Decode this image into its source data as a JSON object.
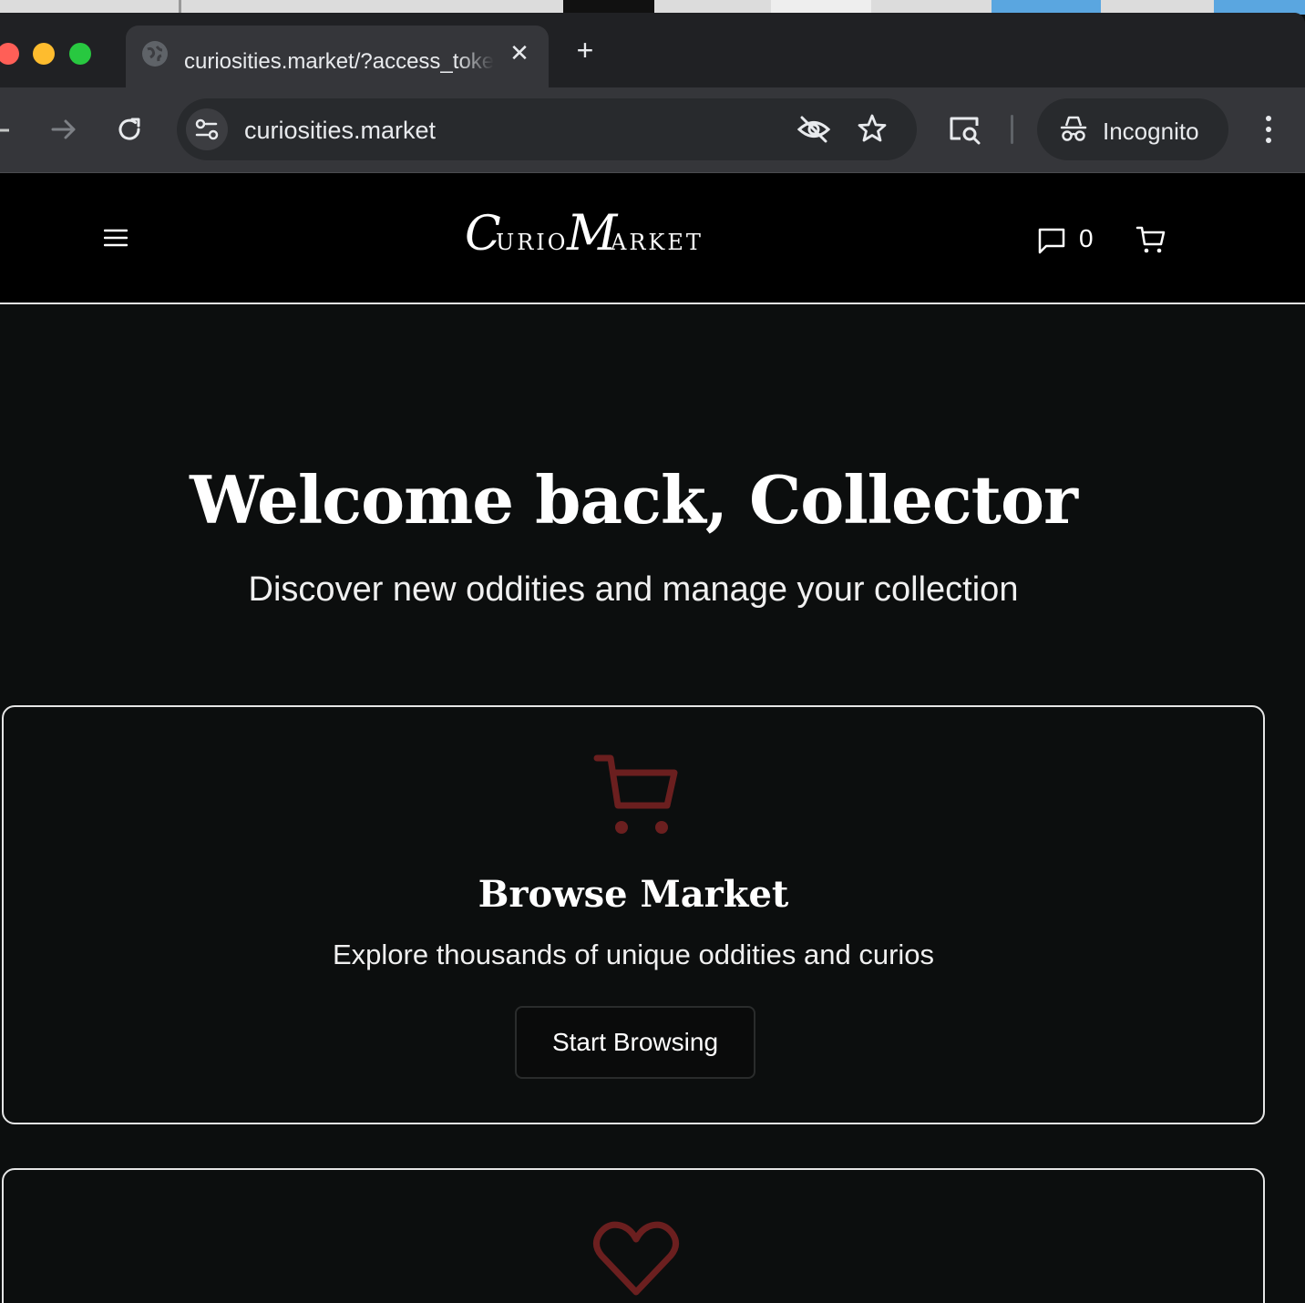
{
  "browser": {
    "tab_title": "curiosities.market/?access_token",
    "tab_close": "✕",
    "new_tab": "+",
    "url": "curiosities.market",
    "incognito_label": "Incognito"
  },
  "site": {
    "logo_text": "Curio Market",
    "messages_count": "0"
  },
  "hero": {
    "title": "Welcome back, Collector",
    "subtitle": "Discover new oddities and manage your collection"
  },
  "cards": [
    {
      "icon": "cart-icon",
      "title": "Browse Market",
      "description": "Explore thousands of unique oddities and curios",
      "button": "Start Browsing"
    },
    {
      "icon": "heart-icon"
    }
  ],
  "colors": {
    "accent": "#6b1f1f",
    "page_bg": "#0c0e0e",
    "header_bg": "#000000",
    "chrome_dark": "#202124",
    "chrome_toolbar": "#35363a"
  }
}
